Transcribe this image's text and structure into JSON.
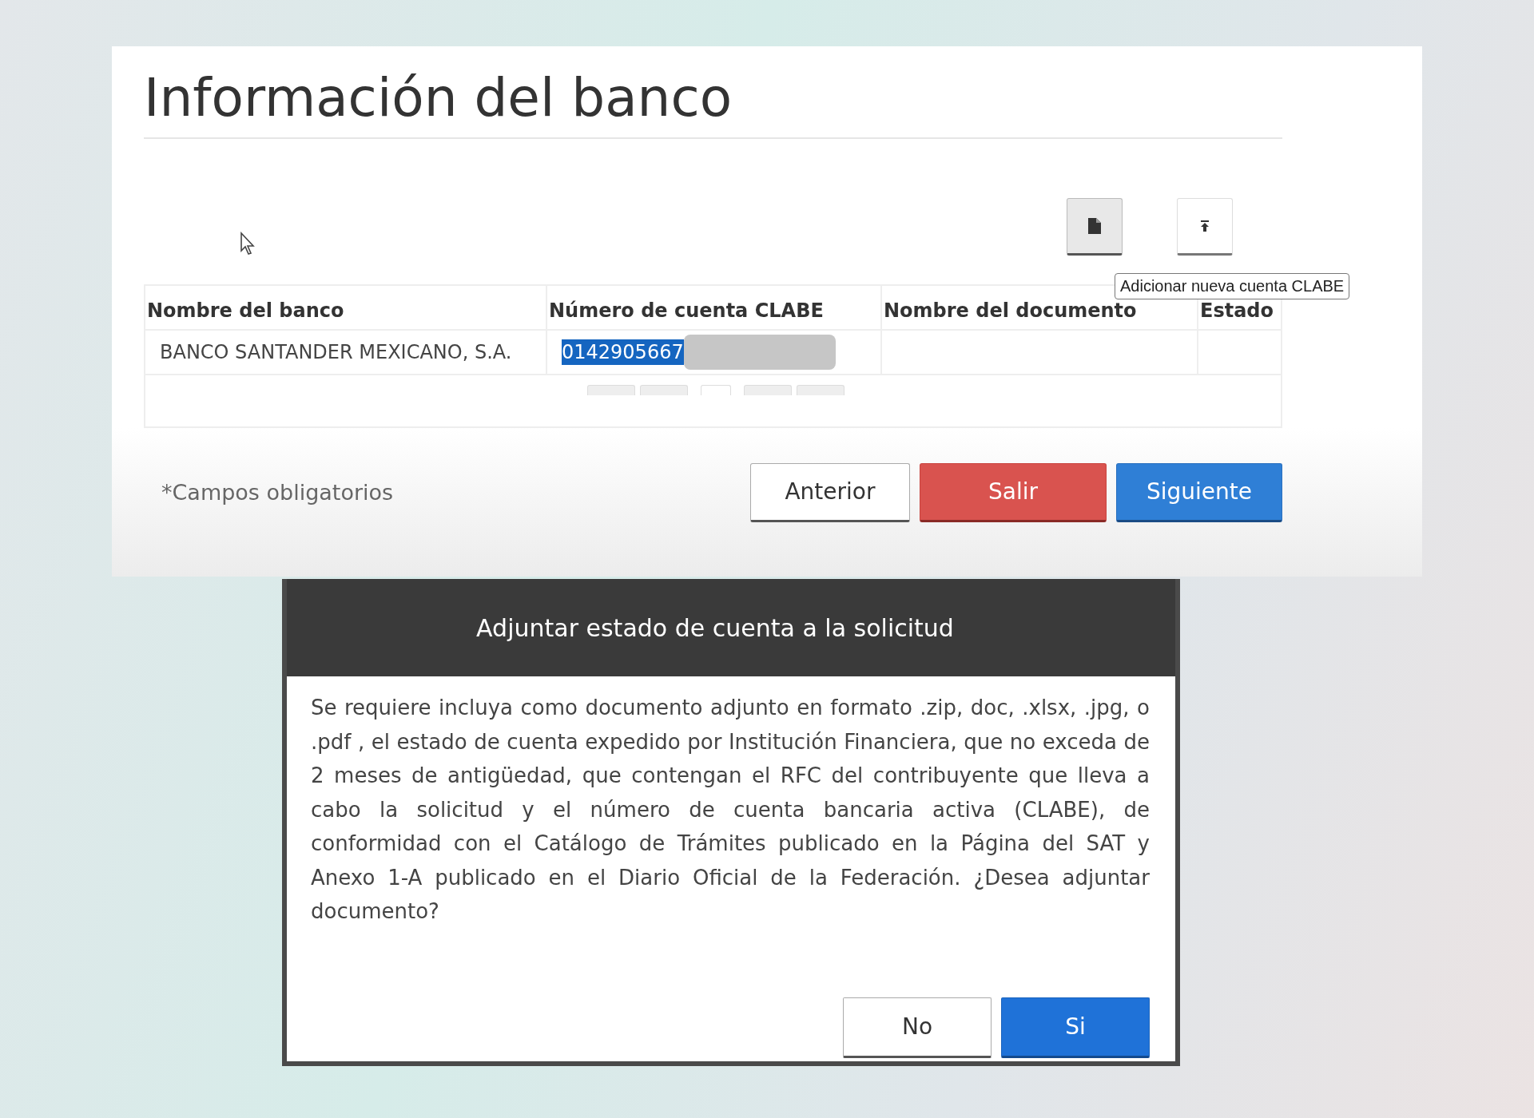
{
  "page": {
    "title": "Información del banco",
    "toolbar": [
      {
        "kind": "document",
        "pressed": true
      },
      {
        "kind": "upload",
        "pressed": false
      }
    ],
    "tooltip": "Adicionar nueva cuenta CLABE",
    "table": {
      "columns": [
        "Nombre del banco",
        "Número de cuenta CLABE",
        "Nombre del documento",
        "Estado"
      ],
      "rows": [
        {
          "bank": "BANCO SANTANDER MEXICANO, S.A.",
          "clabe": "0142905667",
          "clabe_highlighted": true,
          "clabe_redacted": true
        }
      ]
    },
    "note": "*Campos obligatorios",
    "buttons": [
      {
        "label": "Anterior",
        "kind": "default"
      },
      {
        "label": "Salir",
        "kind": "danger"
      },
      {
        "label": "Siguiente",
        "kind": "primary"
      }
    ]
  },
  "dialog": {
    "title": "Adjuntar estado de cuenta a la solicitud",
    "message": "Se requiere incluya como documento adjunto en formato .zip, doc, .xlsx, .jpg, o .pdf , el estado de cuenta expedido por Institución Financiera, que no exceda de 2 meses de antigüedad, que contengan el RFC del contribuyente que lleva a cabo la solicitud y el número de cuenta bancaria activa (CLABE), de conformidad con el Catálogo de Trámites publicado en la Página del SAT y Anexo 1-A publicado en el Diario Oficial de la Federación. ¿Desea adjuntar documento?",
    "buttons": [
      {
        "label": "No",
        "kind": "default"
      },
      {
        "label": "Si",
        "kind": "primary"
      }
    ]
  }
}
